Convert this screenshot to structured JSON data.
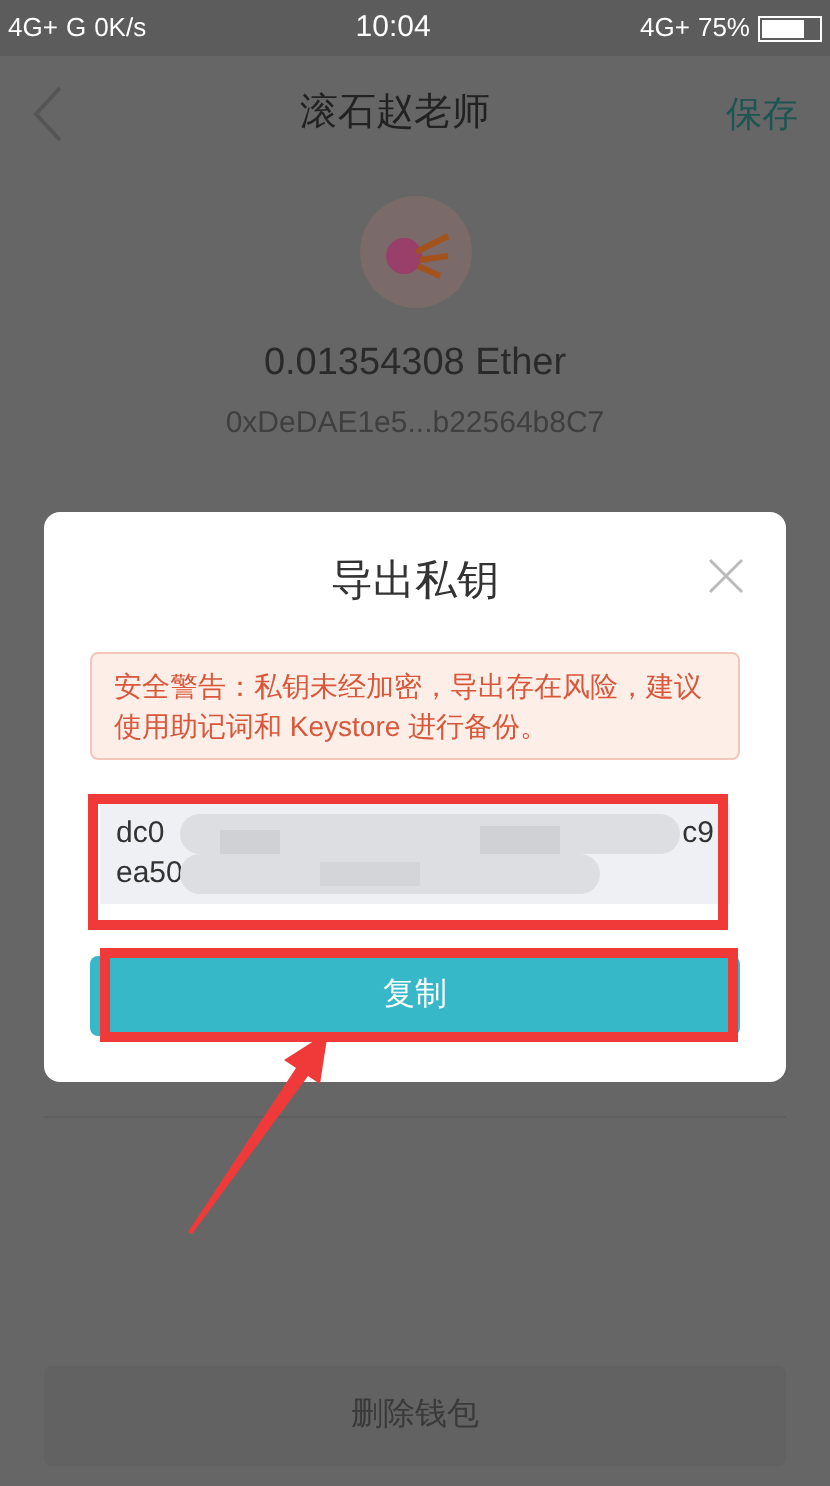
{
  "status_bar": {
    "left": [
      "4G+",
      "G",
      "0K/s"
    ],
    "time": "10:04",
    "network": "4G+",
    "battery": "75%"
  },
  "header": {
    "title": "滚石赵老师",
    "action": "保存"
  },
  "wallet": {
    "balance": "0.01354308 Ether",
    "address": "0xDeDAE1e5...b22564b8C7"
  },
  "delete_button": "删除钱包",
  "dialog": {
    "title": "导出私钥",
    "warning": "安全警告：私钥未经加密，导出存在风险，建议使用助记词和 Keystore 进行备份。",
    "key_lines": [
      {
        "start": "dc0",
        "end": "c9"
      },
      {
        "start": "ea50"
      }
    ],
    "copy_button": "复制"
  }
}
